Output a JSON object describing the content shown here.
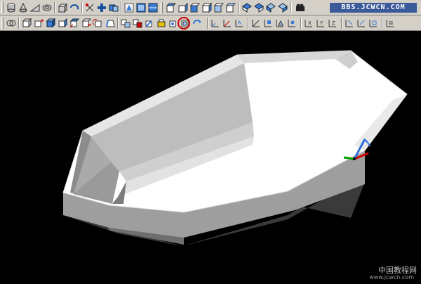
{
  "watermark_top": "BBS.JCWCN.COM",
  "watermark_bottom": "中国教程网",
  "watermark_bottom_url": "www.jcwcn.com",
  "toolbar_row1_icons": [
    "cylinder-icon",
    "cone-icon",
    "wedge-icon",
    "torus-icon",
    "extrude-icon",
    "revolve-icon",
    "slice-icon",
    "section-icon",
    "interfere-icon",
    "shade-icon",
    "render-icon",
    "scene-icon",
    "view-top-icon",
    "view-bottom-icon",
    "view-left-icon",
    "view-right-icon",
    "view-front-icon",
    "view-back-icon",
    "iso-sw-icon",
    "iso-se-icon",
    "iso-ne-icon",
    "iso-nw-icon",
    "camera-icon"
  ],
  "toolbar_row2_icons": [
    "union-icon",
    "subtract-icon",
    "intersect-icon",
    "extrude-faces-icon",
    "move-faces-icon",
    "offset-faces-icon",
    "delete-faces-icon",
    "rotate-faces-icon",
    "taper-faces-icon",
    "copy-faces-icon",
    "color-faces-icon",
    "copy-edges-icon",
    "color-edges-icon",
    "imprint-icon",
    "clean-icon",
    "separate-icon",
    "shell-icon",
    "check-icon",
    "ucs-icon",
    "ucs-world-icon",
    "ucs-object-icon",
    "ucs-face-icon",
    "ucs-view-icon",
    "ucs-origin-icon",
    "ucs-zaxis-icon",
    "ucs-3point-icon",
    "ucs-x-icon",
    "ucs-y-icon",
    "ucs-z-icon",
    "ucs-apply-icon",
    "ucs-manager-icon"
  ],
  "colors": {
    "toolbar": "#d4d0c8",
    "viewport": "#000000",
    "highlight": "#d00000",
    "model_top": "#ffffff",
    "model_side": "#a9a9a9"
  }
}
